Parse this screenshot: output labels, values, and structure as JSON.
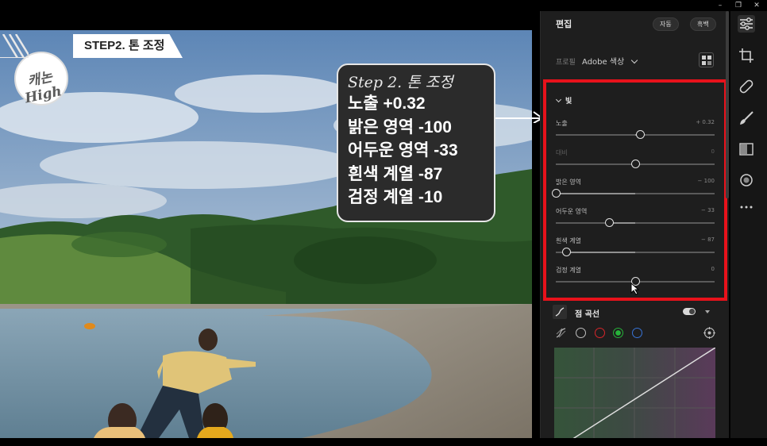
{
  "window": {
    "minimize_glyph": "–",
    "restore_glyph": "❐",
    "close_glyph": "✕"
  },
  "overlay": {
    "logo_text": "캐논 High",
    "step_banner": "STEP2. 톤 조정",
    "callout": {
      "title": "Step 2. 톤 조정",
      "lines": [
        "노출 +0.32",
        "밝은 영역 -100",
        "어두운 영역 -33",
        "흰색 계열 -87",
        "검정 계열 -10"
      ]
    }
  },
  "panel": {
    "title": "편집",
    "auto_button": "자동",
    "bw_button": "흑백",
    "profile_label": "프로필",
    "profile_value": "Adobe 색상",
    "light_section": "빛",
    "sliders": [
      {
        "label": "노출",
        "value": "+ 0.32",
        "level": 0.53,
        "dim": false
      },
      {
        "label": "대비",
        "value": "0",
        "level": 0.5,
        "dim": true
      },
      {
        "label": "밝은 영역",
        "value": "− 100",
        "level": 0.0,
        "dim": false
      },
      {
        "label": "어두운 영역",
        "value": "− 33",
        "level": 0.335,
        "dim": false
      },
      {
        "label": "흰색 계열",
        "value": "− 87",
        "level": 0.065,
        "dim": false
      },
      {
        "label": "검정 계열",
        "value": "0",
        "level": 0.5,
        "dim": false
      }
    ],
    "curve_section": "점 곡선",
    "channel_colors": [
      "#bfbfbf",
      "#d8262b",
      "#27b33a",
      "#3873d6"
    ]
  },
  "toolbar": {
    "tools": [
      "sliders-icon",
      "crop-icon",
      "healing-icon",
      "brush-icon",
      "gradient-icon",
      "radial-icon",
      "more-icon"
    ]
  }
}
